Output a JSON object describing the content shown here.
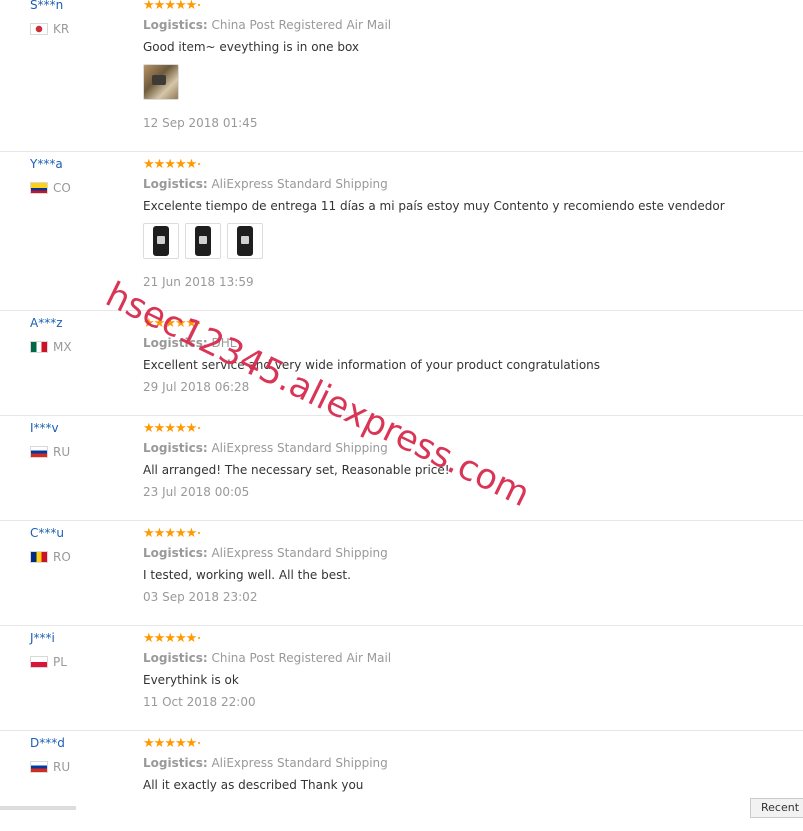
{
  "reviews": [
    {
      "buyer": "S***n",
      "country": "KR",
      "flag": [
        "#ffffff",
        "#ffffff"
      ],
      "rating": 5,
      "logistics_label": "Logistics:",
      "logistics": "China Post Registered Air Mail",
      "text": "Good item~ eveything is in one box",
      "photos": [
        "p1"
      ],
      "date": "12 Sep 2018 01:45"
    },
    {
      "buyer": "Y***a",
      "country": "CO",
      "flag": [
        "#fcd116",
        "#003893",
        "#ce1126"
      ],
      "rating": 5,
      "logistics_label": "Logistics:",
      "logistics": "AliExpress Standard Shipping",
      "text": "Excelente tiempo de entrega 11 días a mi país estoy muy Contento y recomiendo este vendedor",
      "photos": [
        "p2",
        "p3",
        "p4"
      ],
      "date": "21 Jun 2018 13:59"
    },
    {
      "buyer": "A***z",
      "country": "MX",
      "flag": [
        "#006847",
        "#ffffff",
        "#ce1126"
      ],
      "rating": 5,
      "logistics_label": "Logistics:",
      "logistics": "DHL",
      "text": "Excellent service and very wide information of your product congratulations",
      "photos": [],
      "date": "29 Jul 2018 06:28"
    },
    {
      "buyer": "I***v",
      "country": "RU",
      "flag": [
        "#ffffff",
        "#0039a6",
        "#d52b1e"
      ],
      "rating": 5,
      "logistics_label": "Logistics:",
      "logistics": "AliExpress Standard Shipping",
      "text": "All arranged! The necessary set, Reasonable price!",
      "photos": [],
      "date": "23 Jul 2018 00:05"
    },
    {
      "buyer": "C***u",
      "country": "RO",
      "flag": [
        "#002b7f",
        "#fcd116",
        "#ce1126"
      ],
      "rating": 5,
      "logistics_label": "Logistics:",
      "logistics": "AliExpress Standard Shipping",
      "text": "I tested, working well. All the best.",
      "photos": [],
      "date": "03 Sep 2018 23:02"
    },
    {
      "buyer": "J***i",
      "country": "PL",
      "flag": [
        "#ffffff",
        "#dc143c"
      ],
      "rating": 5,
      "logistics_label": "Logistics:",
      "logistics": "China Post Registered Air Mail",
      "text": "Everythink is ok",
      "photos": [],
      "date": "11 Oct 2018 22:00"
    },
    {
      "buyer": "D***d",
      "country": "RU",
      "flag": [
        "#ffffff",
        "#0039a6",
        "#d52b1e"
      ],
      "rating": 5,
      "logistics_label": "Logistics:",
      "logistics": "AliExpress Standard Shipping",
      "text": "All it exactly as described Thank you",
      "photos": [],
      "date": ""
    }
  ],
  "watermark": "hsec12345.aliexpress.com",
  "recent_tab": "Recent",
  "colors": {
    "star": "#ff9900",
    "buyer_link": "#1a5fb4",
    "watermark": "#d82b4e"
  }
}
